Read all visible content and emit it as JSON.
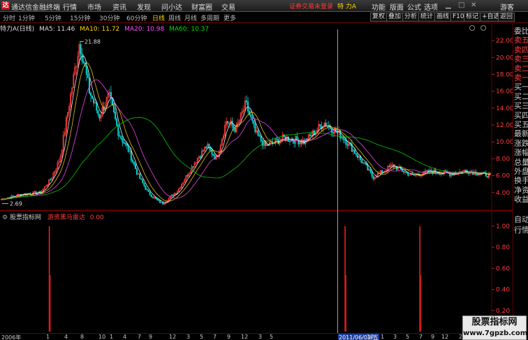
{
  "titlebar": {
    "app_name": "通达信金融终端",
    "menus": [
      "行情",
      "市场",
      "资讯",
      "发现",
      "问小达",
      "财富圈",
      "交易"
    ],
    "notice": "证券交易未登录",
    "stock_name": "特 力A",
    "right_menus": [
      "功能",
      "版面",
      "公式",
      "选项"
    ],
    "guest": "游客"
  },
  "toolbar": {
    "periods": [
      "分时",
      "1分钟",
      "5分钟",
      "15分钟",
      "30分钟",
      "60分钟",
      "日线",
      "周线",
      "月线",
      "多周期",
      "更多"
    ],
    "active_period": "日线",
    "buttons": [
      "复权",
      "叠加",
      "分析",
      "统计",
      "画线",
      "F10",
      "标记",
      "+自选",
      "返回"
    ]
  },
  "info": {
    "title": "特力A(日线)",
    "ma5": "MA5: 11.46",
    "ma10": "MA10: 11.72",
    "ma20": "MA20: 10.98",
    "ma60": "MA60: 10.37"
  },
  "sidepanel": {
    "items": [
      "委比",
      "卖五",
      "卖四",
      "卖三",
      "卖二",
      "卖一",
      "买一",
      "买二",
      "买三",
      "买四",
      "买五",
      "最新",
      "涨跌",
      "涨幅",
      "总量",
      "外盘",
      "换手",
      "净资",
      "收益"
    ],
    "lower_items": [
      "自动",
      "行情"
    ]
  },
  "price_axis": [
    "22.00",
    "20.00",
    "18.00",
    "16.00",
    "14.00",
    "12.00",
    "10.00",
    "8.00",
    "6.00",
    "4.00"
  ],
  "annotations": {
    "high": "21.88",
    "low": "2.69"
  },
  "sub_indicator": {
    "source": "股票指标网",
    "name": "游资黑马雷达",
    "value": "0.00",
    "axis": [
      "1.00",
      "0.80",
      "0.60",
      "0.40",
      "0.20"
    ]
  },
  "date_axis": {
    "labels": [
      "2006年",
      "1",
      "4",
      "8",
      "10",
      "1",
      "4",
      "7",
      "9",
      "12",
      "3",
      "5",
      "7",
      "9",
      "12",
      "3",
      "5",
      "2011/06/03/五",
      "10",
      "1",
      "3",
      "5",
      "7",
      "9",
      "12",
      "2",
      "4"
    ],
    "current": "2011/06/03/五"
  },
  "watermark": {
    "line1": "股票指标网",
    "line2": "www.7gpzb.com"
  },
  "colors": {
    "up": "#ff3c3c",
    "down": "#00d4d4",
    "ma5": "#ffffff",
    "ma10": "#ffd500",
    "ma20": "#ff50ff",
    "ma60": "#00e000",
    "signal": "#ff2020",
    "grid": "#6b0000"
  },
  "chart_data": {
    "type": "candlestick",
    "title": "特力A(日线)",
    "ylim": [
      2.0,
      23.0
    ],
    "price_points": [
      [
        0,
        3.2
      ],
      [
        0.04,
        3.8
      ],
      [
        0.08,
        4.0
      ],
      [
        0.1,
        5.5
      ],
      [
        0.12,
        8.0
      ],
      [
        0.14,
        15.0
      ],
      [
        0.16,
        21.88
      ],
      [
        0.18,
        16.0
      ],
      [
        0.2,
        13.0
      ],
      [
        0.22,
        15.5
      ],
      [
        0.24,
        11.0
      ],
      [
        0.26,
        9.0
      ],
      [
        0.28,
        6.0
      ],
      [
        0.3,
        4.0
      ],
      [
        0.32,
        3.0
      ],
      [
        0.33,
        2.69
      ],
      [
        0.36,
        4.2
      ],
      [
        0.4,
        8.0
      ],
      [
        0.42,
        9.5
      ],
      [
        0.44,
        8.0
      ],
      [
        0.46,
        12.5
      ],
      [
        0.48,
        11.5
      ],
      [
        0.5,
        14.5
      ],
      [
        0.52,
        11.0
      ],
      [
        0.54,
        9.5
      ],
      [
        0.58,
        10.5
      ],
      [
        0.62,
        10.0
      ],
      [
        0.66,
        12.3
      ],
      [
        0.7,
        10.5
      ],
      [
        0.74,
        7.5
      ],
      [
        0.76,
        5.8
      ],
      [
        0.8,
        7.2
      ],
      [
        0.84,
        6.0
      ],
      [
        0.88,
        6.5
      ],
      [
        0.92,
        6.2
      ],
      [
        0.95,
        6.6
      ],
      [
        1.0,
        6.0
      ]
    ],
    "signal_x": [
      0.098,
      0.703,
      0.856
    ],
    "signal_values": [
      1.0,
      1.0,
      1.0
    ]
  }
}
